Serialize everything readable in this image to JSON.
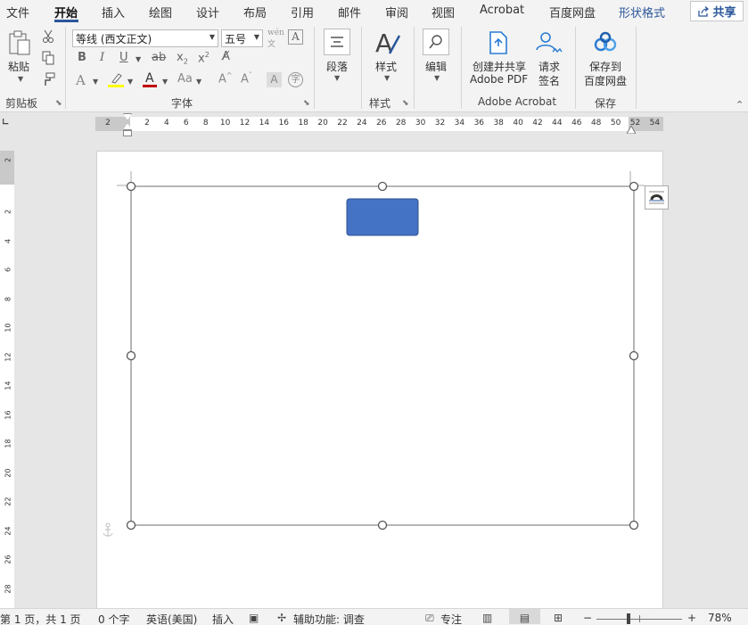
{
  "tabs": [
    {
      "label": "文件"
    },
    {
      "label": "开始",
      "active": true
    },
    {
      "label": "插入"
    },
    {
      "label": "绘图"
    },
    {
      "label": "设计"
    },
    {
      "label": "布局"
    },
    {
      "label": "引用"
    },
    {
      "label": "邮件"
    },
    {
      "label": "审阅"
    },
    {
      "label": "视图"
    },
    {
      "label": "Acrobat"
    },
    {
      "label": "百度网盘"
    },
    {
      "label": "形状格式"
    }
  ],
  "share_label": "共享",
  "ribbon": {
    "clipboard": {
      "paste_label": "粘贴",
      "group_label": "剪贴板"
    },
    "font": {
      "font_name": "等线 (西文正文)",
      "font_size": "五号",
      "group_label": "字体"
    },
    "paragraph": {
      "label": "段落"
    },
    "styles": {
      "label": "样式",
      "group_label": "样式"
    },
    "editing": {
      "label": "编辑"
    },
    "acrobat": {
      "create_line1": "创建并共享",
      "create_line2": "Adobe PDF",
      "sign_line1": "请求",
      "sign_line2": "签名",
      "group_label": "Adobe Acrobat"
    },
    "save": {
      "line1": "保存到",
      "line2": "百度网盘",
      "group_label": "保存"
    }
  },
  "ruler": {
    "h_numbers": [
      "2",
      "2",
      "4",
      "6",
      "8",
      "10",
      "12",
      "14",
      "16",
      "18",
      "20",
      "22",
      "24",
      "26",
      "28",
      "30",
      "32",
      "34",
      "36",
      "38",
      "40",
      "42",
      "44",
      "46",
      "48",
      "50",
      "52",
      "54"
    ],
    "v_numbers": [
      "2",
      "2",
      "4",
      "6",
      "8",
      "10",
      "12",
      "14",
      "16",
      "18",
      "20",
      "22",
      "24",
      "26",
      "28"
    ]
  },
  "status": {
    "page": "第 1 页，共 1 页",
    "words": "0 个字",
    "language": "英语(美国)",
    "mode": "插入",
    "accessibility": "辅助功能: 调查",
    "focus": "专注",
    "zoom": "78%"
  },
  "colors": {
    "accent": "#2b579a",
    "shape_fill": "#4472c4",
    "shape_border": "#2f528f",
    "font_color_bar": "#c00000",
    "highlight_bar": "#ffff00"
  }
}
